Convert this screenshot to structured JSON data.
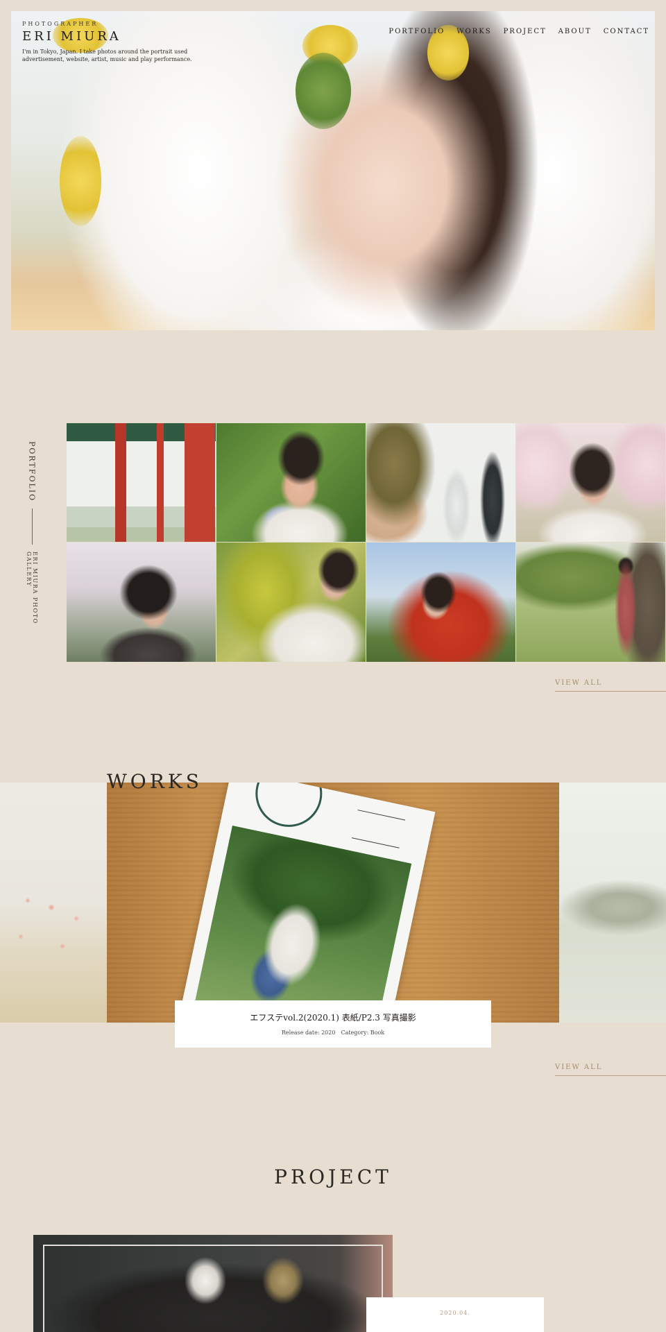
{
  "hero": {
    "kicker": "PHOTOGRAPHER",
    "name": "ERI MIURA",
    "description": "I'm in Tokyo, Japan. I take photos around the portrait used advertisement, website, artist, music and play performance."
  },
  "nav": {
    "items": [
      "PORTFOLIO",
      "WORKS",
      "PROJECT",
      "ABOUT",
      "CONTACT"
    ]
  },
  "portfolio": {
    "label": "PORTFOLIO",
    "sublabel": "ERI MIURA PHOTO GALLERY",
    "view_all": "VIEW ALL"
  },
  "works": {
    "title": "WORKS",
    "caption_title": "エフステvol.2(2020.1) 表紙/P2.3 写真撮影",
    "caption_meta": "Release date: 2020　Category: Book",
    "view_all": "VIEW ALL"
  },
  "project": {
    "title": "PROJECT",
    "date": "2020.04."
  },
  "colors": {
    "background": "#e7ddd0",
    "accent": "#a58d6b",
    "text": "#2a2622"
  }
}
